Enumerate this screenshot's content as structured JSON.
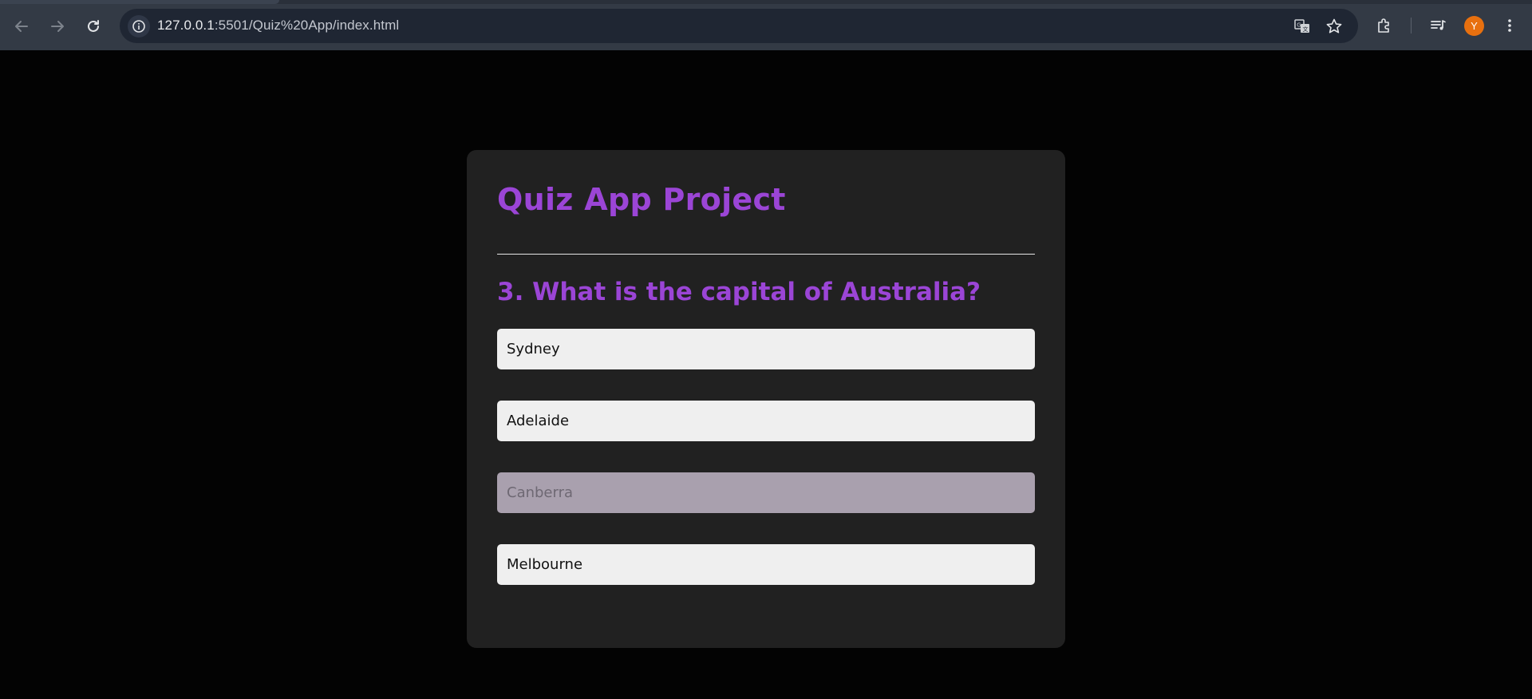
{
  "browser": {
    "url_host": "127.0.0.1",
    "url_rest": ":5501/Quiz%20App/index.html",
    "avatar_initial": "Y",
    "avatar_color": "#e8700f",
    "icons": [
      "back-arrow-icon",
      "forward-arrow-icon",
      "reload-icon",
      "site-info-icon",
      "translate-icon",
      "bookmark-star-icon",
      "extensions-icon",
      "media-control-icon",
      "more-menu-icon"
    ]
  },
  "quiz": {
    "title": "Quiz App Project",
    "question": "3. What is the capital of Australia?",
    "answers": [
      {
        "label": "Sydney",
        "state": "normal"
      },
      {
        "label": "Adelaide",
        "state": "normal"
      },
      {
        "label": "Canberra",
        "state": "disabled"
      },
      {
        "label": "Melbourne",
        "state": "normal"
      }
    ],
    "accent_color": "#9b45d6",
    "card_color": "#212121",
    "background_color": "#030303"
  }
}
